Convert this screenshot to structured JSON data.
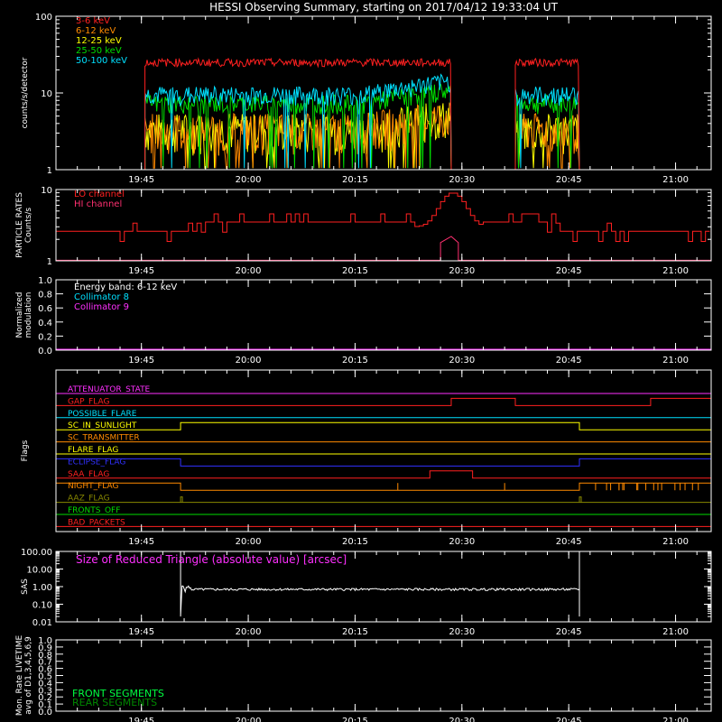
{
  "title": "HESSI Observing Summary, starting on 2017/04/12 19:33:04 UT",
  "time_axis": {
    "start_min": 0,
    "end_min": 92,
    "tick_labels": [
      "19:45",
      "20:00",
      "20:15",
      "20:30",
      "20:45",
      "21:00"
    ],
    "tick_minutes": [
      12,
      27,
      42,
      57,
      72,
      87
    ]
  },
  "chart_data": [
    {
      "type": "line",
      "id": "lightcurves",
      "ylabel": "counts/s/detector",
      "yscale": "log",
      "ylim": [
        1,
        100
      ],
      "ytick_labels": [
        "1",
        "10",
        "100"
      ],
      "ytick_values": [
        1,
        10,
        100
      ],
      "legend_placement": "top-left",
      "gaps_min": [
        [
          55.5,
          64.5
        ]
      ],
      "data_start_min": 12.5,
      "data_end_min": 73.5,
      "series": [
        {
          "name": "3-6 keV",
          "color": "#ff2020",
          "level": 25
        },
        {
          "name": "6-12 keV",
          "color": "#ff8a00",
          "level": 3
        },
        {
          "name": "12-25 keV",
          "color": "#ffff00",
          "level": 3
        },
        {
          "name": "25-50 keV",
          "color": "#00dd00",
          "level": 7
        },
        {
          "name": "50-100 keV",
          "color": "#00e0ff",
          "level": 9
        }
      ]
    },
    {
      "type": "line",
      "id": "particle-rates",
      "ylabel": [
        "PARTICLE RATES",
        "Counts/s"
      ],
      "yscale": "log",
      "ylim": [
        1,
        10
      ],
      "ytick_labels": [
        "1",
        "10"
      ],
      "ytick_values": [
        1,
        10
      ],
      "series": [
        {
          "name": "LO channel",
          "color": "#ff2020",
          "level": 2.8
        },
        {
          "name": "HI channel",
          "color": "#ff3070",
          "level": 1
        }
      ]
    },
    {
      "type": "line",
      "id": "modulation",
      "ylabel": [
        "Normalized",
        "modulation"
      ],
      "ylim": [
        0,
        1
      ],
      "ytick_labels": [
        "0.0",
        "0.2",
        "0.4",
        "0.6",
        "0.8",
        "1.0"
      ],
      "ytick_values": [
        0,
        0.2,
        0.4,
        0.6,
        0.8,
        1.0
      ],
      "annotation": "Energy band: 6-12 keV",
      "series": [
        {
          "name": "Collimator 8",
          "color": "#00e0ff",
          "level": 0
        },
        {
          "name": "Collimator 9",
          "color": "#ff30ff",
          "level": 0
        }
      ]
    },
    {
      "type": "line",
      "id": "flags",
      "ylabel": "Flags",
      "series": [
        {
          "name": "ATTENUATOR_STATE",
          "color": "#ff30ff",
          "on": []
        },
        {
          "name": "GAP_FLAG",
          "color": "#ff2020",
          "on": [
            [
              55.5,
              64.5
            ],
            [
              83.5,
              92
            ]
          ]
        },
        {
          "name": "POSSIBLE_FLARE",
          "color": "#00e0ff",
          "on": []
        },
        {
          "name": "SC_IN_SUNLIGHT",
          "color": "#ffff00",
          "on": [
            [
              17.5,
              73.5
            ]
          ]
        },
        {
          "name": "SC_TRANSMITTER",
          "color": "#ff8a00",
          "on": []
        },
        {
          "name": "FLARE_FLAG",
          "color": "#ffff00",
          "on": []
        },
        {
          "name": "ECLIPSE_FLAG",
          "color": "#3030ff",
          "on": [
            [
              0,
              17.5
            ],
            [
              73.5,
              92
            ]
          ]
        },
        {
          "name": "SAA_FLAG",
          "color": "#ff2020",
          "on": [
            [
              52.5,
              58.5
            ]
          ]
        },
        {
          "name": "NIGHT_FLAG",
          "color": "#ff8a00",
          "on": [
            [
              0,
              17.5
            ],
            [
              73.5,
              92
            ]
          ]
        },
        {
          "name": "AAZ_FLAG",
          "color": "#888800",
          "on": []
        },
        {
          "name": "FRONTS_OFF",
          "color": "#00dd00",
          "on": []
        },
        {
          "name": "BAD_PACKETS",
          "color": "#ff2020",
          "on": []
        }
      ]
    },
    {
      "type": "line",
      "id": "sas",
      "ylabel": "SAS",
      "yscale": "log",
      "ylim": [
        0.01,
        100
      ],
      "ytick_labels": [
        "0.01",
        "0.10",
        "1.00",
        "10.00",
        "100.00"
      ],
      "ytick_values": [
        0.01,
        0.1,
        1,
        10,
        100
      ],
      "annotation": "Size of Reduced Triangle (absolute value) [arcsec]",
      "series": [
        {
          "name": "SAS triangle",
          "color": "#ffffff",
          "start_min": 17.5,
          "end_min": 73.5,
          "level": 0.7
        }
      ]
    },
    {
      "type": "line",
      "id": "livetime",
      "ylabel": [
        "Mon. Rate LIVETIME",
        "avg of D1,3,4,5,6,9"
      ],
      "ylim": [
        0,
        1
      ],
      "ytick_labels": [
        "0.0",
        "0.1",
        "0.2",
        "0.3",
        "0.4",
        "0.5",
        "0.6",
        "0.7",
        "0.8",
        "0.9",
        "1.0"
      ],
      "ytick_values": [
        0,
        0.1,
        0.2,
        0.3,
        0.4,
        0.5,
        0.6,
        0.7,
        0.8,
        0.9,
        1.0
      ],
      "series": [
        {
          "name": "FRONT SEGMENTS",
          "color": "#00ff40"
        },
        {
          "name": "REAR SEGMENTS",
          "color": "#008800"
        }
      ]
    }
  ]
}
